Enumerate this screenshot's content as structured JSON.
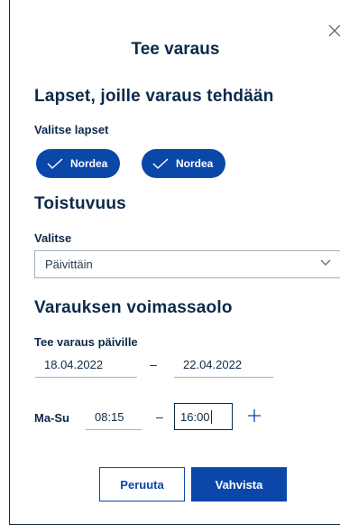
{
  "dialog": {
    "title": "Tee varaus"
  },
  "children_section": {
    "heading": "Lapset, joille varaus tehdään",
    "label": "Valitse lapset",
    "chips": [
      {
        "label": "Nordea",
        "selected": true
      },
      {
        "label": "Nordea",
        "selected": true
      }
    ]
  },
  "recurrence_section": {
    "heading": "Toistuvuus",
    "label": "Valitse",
    "selected_value": "Päivittäin"
  },
  "validity_section": {
    "heading": "Varauksen voimassaolo",
    "date_label": "Tee varaus päiville",
    "start_date": "18.04.2022",
    "end_date": "22.04.2022",
    "dash": "–",
    "day_range_label": "Ma-Su",
    "start_time": "08:15",
    "end_time": "16:00"
  },
  "actions": {
    "cancel_label": "Peruuta",
    "confirm_label": "Vahvista"
  },
  "colors": {
    "primary": "#0a47a8",
    "text": "#0b2a4a",
    "border": "#a7b1bd"
  },
  "icons": {
    "close": "close-icon",
    "check": "check-icon",
    "chevron": "chevron-down-icon",
    "plus": "plus-icon"
  }
}
